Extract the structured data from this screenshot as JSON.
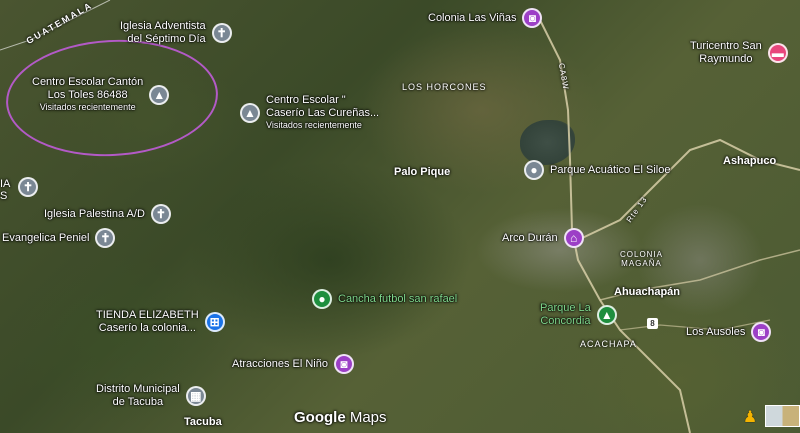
{
  "map": {
    "country_label": "GUATEMALA",
    "logo": {
      "brand": "Google",
      "product": "Maps"
    },
    "area_labels": {
      "los_horcones": "LOS HORCONES",
      "colonia_magana": "COLONIA\nMAGAÑA",
      "acachapa": "ACACHAPA"
    },
    "places": {
      "palo_pique": "Palo Pique",
      "ashapuco": "Ashapuco",
      "ahuachapan": "Ahuachapán",
      "tacuba": "Tacuba",
      "edge_label": "IA\nS"
    },
    "road_labels": {
      "ca8w": "CA8W",
      "rte13": "Rte 13",
      "shield_8": "8"
    },
    "pois": {
      "iglesia_adventista": {
        "label": "Iglesia Adventista\ndel Séptimo Día",
        "icon": "cross-icon"
      },
      "centro_los_toles": {
        "label": "Centro Escolar Cantón\nLos Toles 86488",
        "sub": "Visitados recientemente",
        "icon": "school-icon"
      },
      "centro_curenas": {
        "label": "Centro Escolar \"\nCaserío Las Cureñas...",
        "sub": "Visitados recientemente",
        "icon": "school-icon"
      },
      "colonia_las_vinas": {
        "label": "Colonia Las Viñas",
        "icon": "camera-icon"
      },
      "turicentro": {
        "label": "Turicentro San\nRaymundo",
        "icon": "bed-icon"
      },
      "parque_acuatico": {
        "label": "Parque Acuático El Siloe",
        "icon": "pin-dot-icon"
      },
      "arco_duran": {
        "label": "Arco Durán",
        "icon": "landmark-icon"
      },
      "iglesia_palestina": {
        "label": "Iglesia Palestina A/D",
        "icon": "cross-icon"
      },
      "evangelica_peniel": {
        "label": "Evangelica Peniel",
        "icon": "cross-icon"
      },
      "edge_cross": {
        "label": "",
        "icon": "cross-icon"
      },
      "cancha_futbol": {
        "label": "Cancha futbol san rafael",
        "icon": "pin-dot-icon"
      },
      "tienda_elizabeth": {
        "label": "TIENDA ELIZABETH\nCaserío la colonia...",
        "icon": "cart-icon"
      },
      "parque_concordia": {
        "label": "Parque La\nConcordia",
        "icon": "tree-icon"
      },
      "los_ausoles": {
        "label": "Los Ausoles",
        "icon": "camera-icon"
      },
      "atracciones_nino": {
        "label": "Atracciones El Niño",
        "icon": "camera-icon"
      },
      "distrito_tacuba": {
        "label": "Distrito Municipal\nde Tacuba",
        "icon": "building-icon"
      }
    },
    "colors": {
      "church": "#7a8794",
      "shop": "#1a73e8",
      "attraction": "#9c3fc6",
      "lodging": "#e8467c",
      "park": "#1e8e3e",
      "annotation": "#b35ac7"
    }
  }
}
